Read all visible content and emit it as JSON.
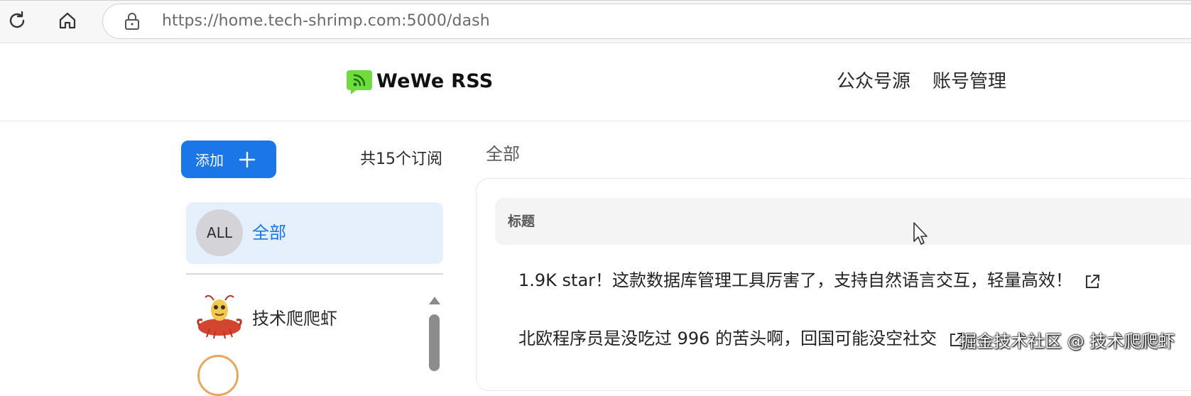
{
  "browser": {
    "url": "https://home.tech-shrimp.com:5000/dash",
    "icons": [
      "reload-icon",
      "home-icon",
      "lock-icon"
    ]
  },
  "header": {
    "app_title": "WeWe RSS",
    "logo_icon": "rss-icon",
    "nav": [
      {
        "label": "公众号源"
      },
      {
        "label": "账号管理"
      }
    ]
  },
  "sidebar": {
    "add_label": "添加",
    "subscription_count": "共15个订阅",
    "all_item": {
      "avatar_text": "ALL",
      "label": "全部"
    },
    "feeds": [
      {
        "label": "技术爬爬虾"
      }
    ]
  },
  "main": {
    "section_title": "全部",
    "table_header": "标题",
    "articles": [
      {
        "title": "1.9K star！这款数据库管理工具厉害了，支持自然语言交互，轻量高效！"
      },
      {
        "title": "北欧程序员是没吃过 996 的苦头啊，回国可能没空社交"
      }
    ]
  },
  "watermark": "掘金技术社区 @ 技术爬爬虾",
  "colors": {
    "accent": "#1b76e8",
    "selected_bg": "#e6f0fc",
    "logo_green": "#6fdc3c",
    "table_header_bg": "#f4f4f5"
  }
}
